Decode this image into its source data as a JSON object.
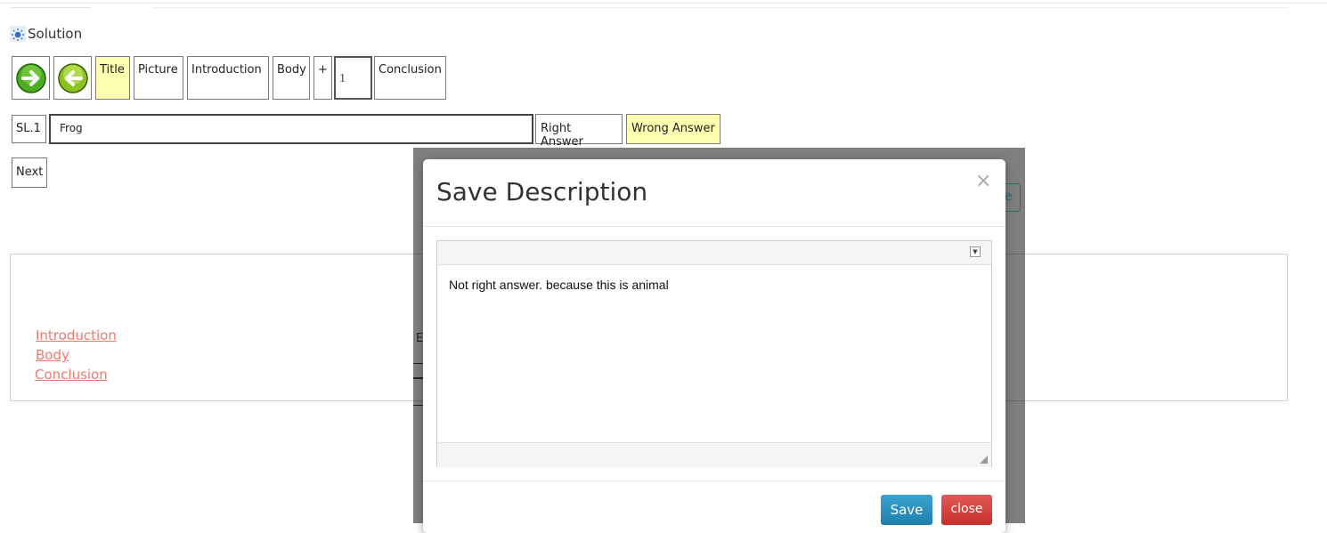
{
  "solution": {
    "title": "Solution",
    "icon": "sun-icon"
  },
  "toolbar": {
    "next_arrow_icon": "arrow-right-circle-icon",
    "prev_arrow_icon": "arrow-left-circle-icon",
    "title_label": "Title",
    "picture_label": "Picture",
    "introduction_label": "Introduction",
    "body_label": "Body",
    "plus_label": "+",
    "slide_number": "1",
    "conclusion_label": "Conclusion"
  },
  "answer_row": {
    "sl_label": "SL.1",
    "answer_value": "Frog",
    "right_answer_label": "Right Answer",
    "wrong_answer_label": "Wrong Answer"
  },
  "next_label": "Next",
  "content_links": [
    "Introduction",
    "Body",
    "Conclusion"
  ],
  "background_partial_text": {
    "button_fragment": "e",
    "row_fragment": "E"
  },
  "modal": {
    "title": "Save Description",
    "close_x": "×",
    "editor_text": "Not right answer. because this is animal",
    "save_label": "Save",
    "close_label": "close"
  },
  "colors": {
    "highlight_yellow": "#ffffb0",
    "link_color": "#ee7b6f",
    "save_blue": "#2a8fc0",
    "close_red": "#d9534f"
  }
}
